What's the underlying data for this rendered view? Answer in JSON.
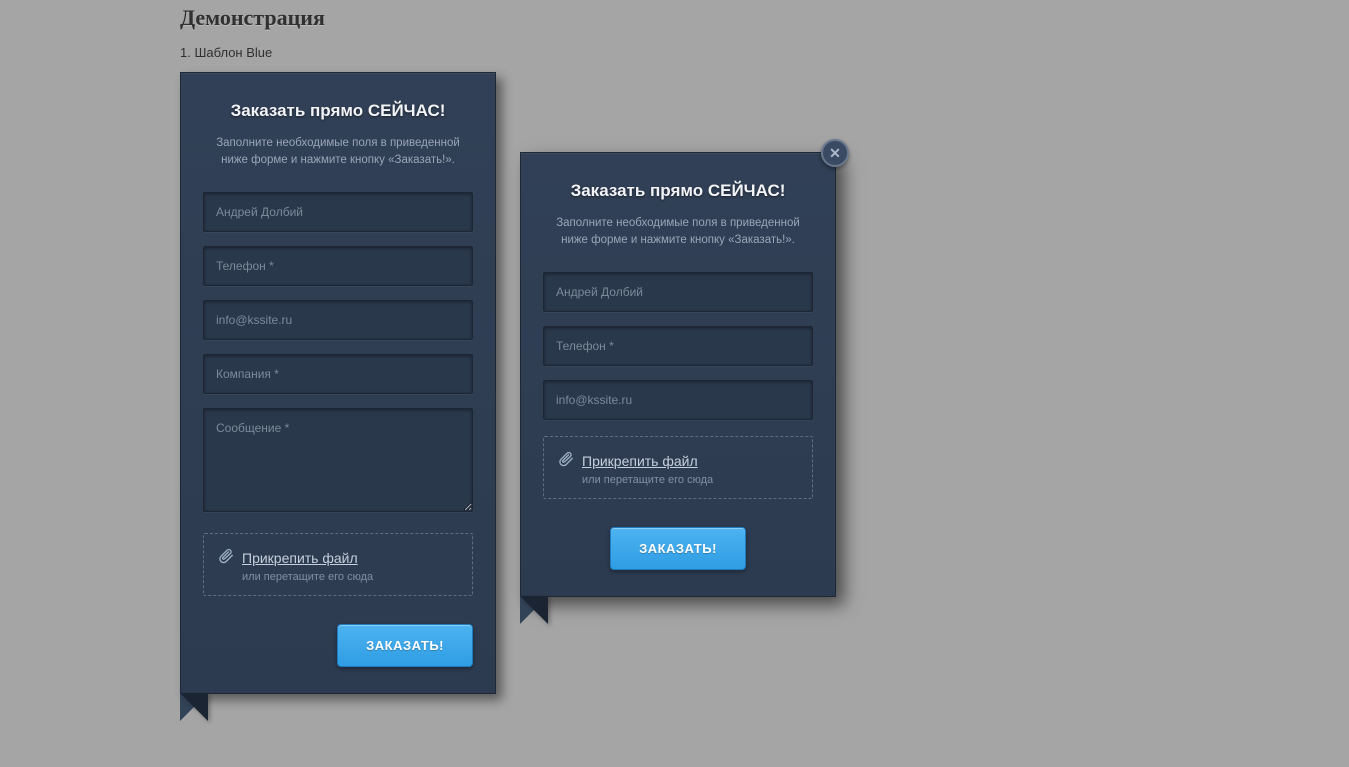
{
  "page": {
    "heading": "Демонстрация",
    "subheading": "1. Шаблон Blue"
  },
  "form1": {
    "title": "Заказать прямо СЕЙЧАС!",
    "description": "Заполните необходимые поля в приведенной ниже форме и нажмите кнопку «Заказать!».",
    "fields": {
      "name_placeholder": "Андрей Долбий",
      "phone_placeholder": "Телефон *",
      "email_placeholder": "info@kssite.ru",
      "company_placeholder": "Компания *",
      "message_placeholder": "Сообщение *"
    },
    "attach": {
      "link": "Прикрепить файл",
      "hint": "или перетащите его сюда"
    },
    "submit": "ЗАКАЗАТЬ!"
  },
  "form2": {
    "title": "Заказать прямо СЕЙЧАС!",
    "description": "Заполните необходимые поля в приведенной ниже форме и нажмите кнопку «Заказать!».",
    "fields": {
      "name_placeholder": "Андрей Долбий",
      "phone_placeholder": "Телефон *",
      "email_placeholder": "info@kssite.ru"
    },
    "attach": {
      "link": "Прикрепить файл",
      "hint": "или перетащите его сюда"
    },
    "submit": "ЗАКАЗАТЬ!"
  }
}
